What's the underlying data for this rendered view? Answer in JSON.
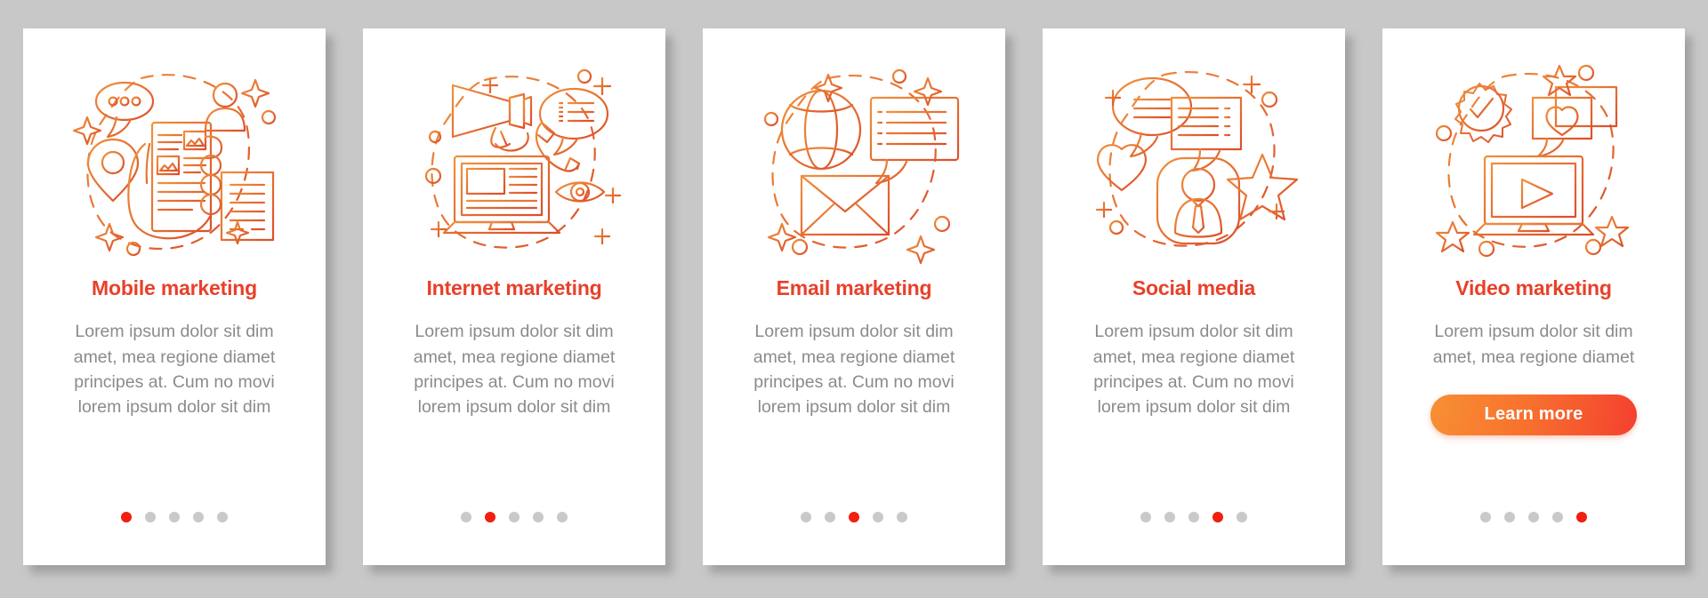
{
  "theme": {
    "background": "#c8c8c8",
    "card_background": "#ffffff",
    "title_color": "#e8402a",
    "body_color": "#8b8b8b",
    "icon_stroke_start": "#f0913c",
    "icon_stroke_end": "#dc4e2a",
    "dot_active_color": "#f01f0f",
    "dot_inactive_color": "#c9c9c9",
    "button_gradient_from": "#f79033",
    "button_gradient_to": "#f4402f"
  },
  "screens": [
    {
      "icon_name": "mobile-marketing-illustration",
      "title": "Mobile marketing",
      "body_lines": [
        "Lorem ipsum dolor sit dim",
        "amet, mea regione diamet",
        "principes at. Cum no movi",
        "lorem ipsum dolor sit dim"
      ],
      "button": null,
      "dots": {
        "count": 5,
        "active_index": 0
      }
    },
    {
      "icon_name": "internet-marketing-illustration",
      "title": "Internet marketing",
      "body_lines": [
        "Lorem ipsum dolor sit dim",
        "amet, mea regione diamet",
        "principes at. Cum no movi",
        "lorem ipsum dolor sit dim"
      ],
      "button": null,
      "dots": {
        "count": 5,
        "active_index": 1
      }
    },
    {
      "icon_name": "email-marketing-illustration",
      "title": "Email marketing",
      "body_lines": [
        "Lorem ipsum dolor sit dim",
        "amet, mea regione diamet",
        "principes at. Cum no movi",
        "lorem ipsum dolor sit dim"
      ],
      "button": null,
      "dots": {
        "count": 5,
        "active_index": 2
      }
    },
    {
      "icon_name": "social-media-illustration",
      "title": "Social media",
      "body_lines": [
        "Lorem ipsum dolor sit dim",
        "amet, mea regione diamet",
        "principes at. Cum no movi",
        "lorem ipsum dolor sit dim"
      ],
      "button": null,
      "dots": {
        "count": 5,
        "active_index": 3
      }
    },
    {
      "icon_name": "video-marketing-illustration",
      "title": "Video marketing",
      "body_lines": [
        "Lorem ipsum dolor sit dim",
        "amet, mea regione diamet"
      ],
      "button": "Learn more",
      "dots": {
        "count": 5,
        "active_index": 4
      }
    }
  ]
}
